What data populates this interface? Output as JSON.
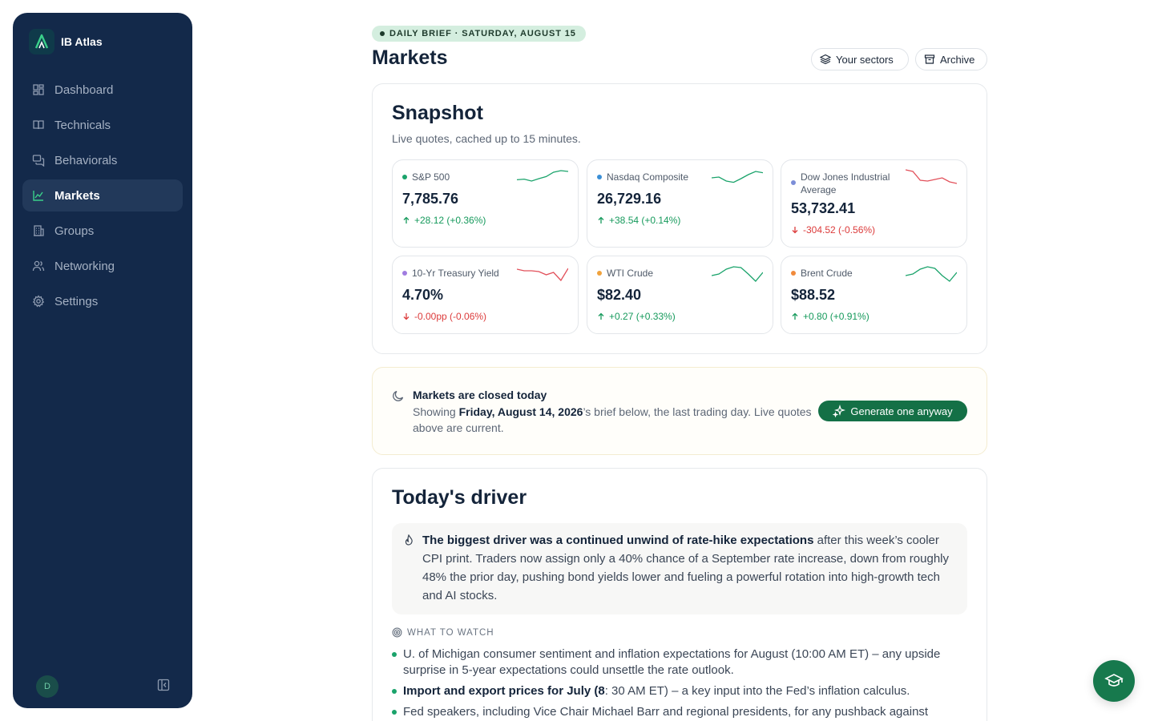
{
  "app": {
    "name": "IB Atlas"
  },
  "sidebar": {
    "items": [
      {
        "label": "Dashboard",
        "icon": "dashboard-icon",
        "active": false
      },
      {
        "label": "Technicals",
        "icon": "book-icon",
        "active": false
      },
      {
        "label": "Behaviorals",
        "icon": "chat-icon",
        "active": false
      },
      {
        "label": "Markets",
        "icon": "chart-line-icon",
        "active": true
      },
      {
        "label": "Groups",
        "icon": "building-icon",
        "active": false
      },
      {
        "label": "Networking",
        "icon": "users-icon",
        "active": false
      },
      {
        "label": "Settings",
        "icon": "gear-icon",
        "active": false
      }
    ],
    "avatar_initial": "D"
  },
  "header": {
    "brief_pill": "DAILY BRIEF · SATURDAY, AUGUST 15",
    "title": "Markets",
    "sectors_label": "Your sectors",
    "archive_label": "Archive"
  },
  "snapshot": {
    "title": "Snapshot",
    "subtitle": "Live quotes, cached up to 15 minutes.",
    "quotes": [
      {
        "name": "S&P 500",
        "value": "7,785.76",
        "change": "+28.12 (+0.36%)",
        "direction": "up",
        "dot_color": "#1aa36b",
        "spark": [
          0.62,
          0.58,
          0.7,
          0.55,
          0.42,
          0.15,
          0.05,
          0.1
        ]
      },
      {
        "name": "Nasdaq Composite",
        "value": "26,729.16",
        "change": "+38.54 (+0.14%)",
        "direction": "up",
        "dot_color": "#3a8fd6",
        "spark": [
          0.5,
          0.45,
          0.7,
          0.78,
          0.55,
          0.3,
          0.1,
          0.18
        ]
      },
      {
        "name": "Dow Jones Industrial Average",
        "value": "53,732.41",
        "change": "-304.52 (-0.56%)",
        "direction": "down",
        "dot_color": "#7c8ed8",
        "spark": [
          0.0,
          0.1,
          0.65,
          0.7,
          0.6,
          0.5,
          0.75,
          0.85
        ]
      },
      {
        "name": "10-Yr Treasury Yield",
        "value": "4.70%",
        "change": "-0.00pp (-0.06%)",
        "direction": "down",
        "dot_color": "#a07ce0",
        "spark": [
          0.2,
          0.3,
          0.3,
          0.35,
          0.55,
          0.4,
          0.9,
          0.15
        ]
      },
      {
        "name": "WTI Crude",
        "value": "$82.40",
        "change": "+0.27 (+0.33%)",
        "direction": "up",
        "dot_color": "#f0a23c",
        "spark": [
          0.6,
          0.5,
          0.2,
          0.05,
          0.1,
          0.5,
          0.95,
          0.4
        ]
      },
      {
        "name": "Brent Crude",
        "value": "$88.52",
        "change": "+0.80 (+0.91%)",
        "direction": "up",
        "dot_color": "#f08a3c",
        "spark": [
          0.6,
          0.5,
          0.2,
          0.05,
          0.15,
          0.6,
          0.95,
          0.4
        ]
      }
    ]
  },
  "notice": {
    "title": "Markets are closed today",
    "body_pre": "Showing ",
    "body_bold": "Friday, August 14, 2026",
    "body_post": "’s brief below, the last trading day. Live quotes above are current.",
    "button_label": "Generate one anyway"
  },
  "driver": {
    "title": "Today's driver",
    "lead_bold": "The biggest driver was a continued unwind of rate-hike expectations",
    "lead_rest": " after this week’s cooler CPI print. Traders now assign only a 40% chance of a September rate increase, down from roughly 48% the prior day, pushing bond yields lower and fueling a powerful rotation into high-growth tech and AI stocks.",
    "watch_header": "WHAT TO WATCH",
    "watch_items": [
      {
        "bold": "",
        "text": "U. of Michigan consumer sentiment and inflation expectations for August (10:00 AM ET) – any upside surprise in 5-year expectations could unsettle the rate outlook."
      },
      {
        "bold": "Import and export prices for July (8",
        "text": ": 30 AM ET) – a key input into the Fed’s inflation calculus."
      },
      {
        "bold": "",
        "text": "Fed speakers, including Vice Chair Michael Barr and regional presidents, for any pushback against"
      }
    ]
  },
  "colors": {
    "sidebar_bg": "#13294a",
    "accent_green": "#147046",
    "up": "#169a5c",
    "down": "#dc3b3b"
  }
}
